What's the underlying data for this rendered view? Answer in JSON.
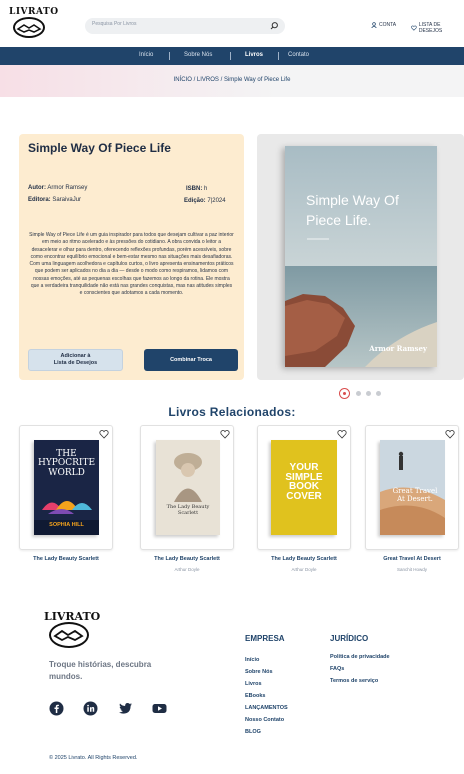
{
  "header": {
    "logo_text": "LIVRATO",
    "search_placeholder": "Pesquisa Por Livros",
    "account_label": "CONTA",
    "wishlist_label": "LISTA DE DESEJOS"
  },
  "nav": {
    "items": [
      {
        "label": "Início"
      },
      {
        "label": "Sobre Nós"
      },
      {
        "label": "Livros"
      },
      {
        "label": "Contato"
      }
    ],
    "active": "Livros"
  },
  "breadcrumb": {
    "home": "INÍCIO",
    "sep": "/",
    "section": "LIVROS",
    "current": "/ Simple Way of Piece Life"
  },
  "book": {
    "title": "Simple Way Of Piece Life",
    "author_label": "Autor:",
    "author": "Armor Ramsey",
    "isbn_label": "ISBN:",
    "isbn": "h",
    "publisher_label": "Editora:",
    "publisher": "SaraivaJur",
    "edition_label": "Edição:",
    "edition": "7|2024",
    "description": "Simple Way of Piece Life é um guia inspirador para todos que desejam cultivar a paz interior em meio ao ritmo acelerado e às pressões do cotidiano. A obra convida o leitor a desacelerar e olhar para dentro, oferecendo reflexões profundas, porém acessíveis, sobre como encontrar equilíbrio emocional e bem-estar mesmo nas situações mais desafiadoras. Com uma linguagem acolhedora e capítulos curtos, o livro apresenta ensinamentos práticos que podem ser aplicados no dia a dia — desde o modo como respiramos, lidamos com nossas emoções, até as pequenas escolhas que fazemos ao longo da rotina. Ele mostra que a verdadeira tranquilidade não está nas grandes conquistas, mas nas atitudes simples e conscientes que adotamos a cada momento.",
    "wishlist_button": [
      "Adicionar à",
      "Lista de Desejos"
    ],
    "swap_button": "Combinar Troca",
    "cover_title": "Simple Way Of Piece Life.",
    "cover_author": "Armor Ramsey"
  },
  "carousel": {
    "count": 4,
    "active": 0
  },
  "related": {
    "title": "Livros Relacionados:",
    "items": [
      {
        "name": "The Lady Beauty Scarlett",
        "author": "",
        "cover_text": "THE HYPOCRITE WORLD",
        "cover_sub": "SOPHIA HILL"
      },
      {
        "name": "The Lady Beauty Scarlett",
        "author": "Arthur Doyle",
        "cover_text": "The Lady Beauty Scarlett"
      },
      {
        "name": "The Lady Beauty Scarlett",
        "author": "Arthur Doyle",
        "cover_text": "YOUR SIMPLE BOOK COVER"
      },
      {
        "name": "Great Travel At Desert",
        "author": "Sanchit Howdy",
        "cover_text": "Great Travel At Desert."
      }
    ]
  },
  "footer": {
    "logo_text": "LIVRATO",
    "tagline": "Troque histórias, descubra mundos.",
    "social": [
      "facebook-icon",
      "linkedin-icon",
      "twitter-icon",
      "youtube-icon"
    ],
    "empresa_title": "EMPRESA",
    "empresa_links": [
      "Início",
      "Sobre Nós",
      "Livros",
      "EBooks",
      "LANÇAMENTOS",
      "Nosso Contato",
      "BLOG"
    ],
    "juridico_title": "JURÍDICO",
    "juridico_links": [
      "Política de privacidade",
      "FAQs",
      "Termos de serviço"
    ],
    "copyright": "© 2025 Livrato. All Rights Reserved."
  },
  "colors": {
    "primary": "#20446a",
    "info_bg": "#fdecd0",
    "accent_red": "#d94d4d"
  }
}
